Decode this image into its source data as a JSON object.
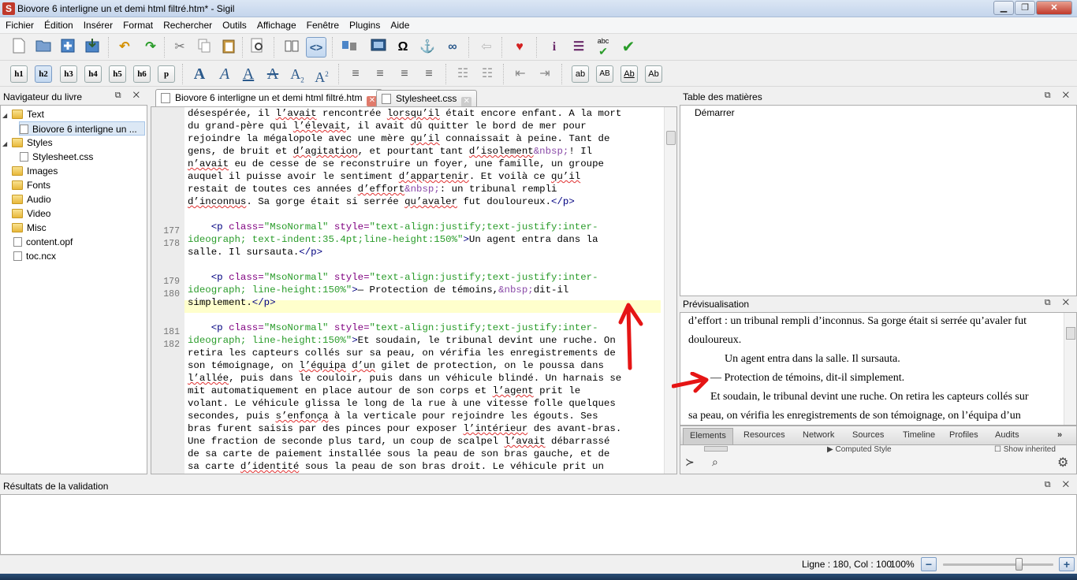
{
  "window": {
    "title": "Biovore 6 interligne un et demi html filtré.htm* - Sigil",
    "app_icon": "S"
  },
  "menu": [
    "Fichier",
    "Édition",
    "Insérer",
    "Format",
    "Rechercher",
    "Outils",
    "Affichage",
    "Fenêtre",
    "Plugins",
    "Aide"
  ],
  "toolbar2": {
    "headings": [
      "h1",
      "h2",
      "h3",
      "h4",
      "h5",
      "h6",
      "p"
    ],
    "active_heading": "h2",
    "abc_label": "abc",
    "case_buttons": [
      "ab",
      "AB",
      "Ab",
      "Ab"
    ]
  },
  "book_browser": {
    "title": "Navigateur du livre",
    "items": [
      {
        "label": "Text",
        "type": "folder",
        "expanded": true
      },
      {
        "label": "Biovore 6 interligne un ...",
        "type": "file",
        "selected": true
      },
      {
        "label": "Styles",
        "type": "folder",
        "expanded": true
      },
      {
        "label": "Stylesheet.css",
        "type": "file"
      },
      {
        "label": "Images",
        "type": "folder"
      },
      {
        "label": "Fonts",
        "type": "folder"
      },
      {
        "label": "Audio",
        "type": "folder"
      },
      {
        "label": "Video",
        "type": "folder"
      },
      {
        "label": "Misc",
        "type": "folder"
      },
      {
        "label": "content.opf",
        "type": "file"
      },
      {
        "label": "toc.ncx",
        "type": "file"
      }
    ]
  },
  "tabs": [
    {
      "label": "Biovore 6 interligne un et demi html filtré.htm",
      "active": true,
      "close": "✕"
    },
    {
      "label": "Stylesheet.css",
      "active": false,
      "close": "✕"
    }
  ],
  "code": {
    "line_numbers": [
      "177",
      "178",
      "179",
      "180",
      "181",
      "182"
    ],
    "highlight_color": "#ffffcc"
  },
  "toc": {
    "title": "Table des matières",
    "entry": "Démarrer"
  },
  "preview": {
    "title": "Prévisualisation",
    "lines": [
      "d’effort : un tribunal rempli d’inconnus. Sa gorge était si serrée qu’avaler fut",
      "douloureux.",
      "Un agent entra dans la salle. Il sursauta.",
      "— Protection de témoins, dit-il simplement.",
      "Et soudain, le tribunal devint une ruche. On retira les capteurs collés sur",
      "sa peau, on vérifia les enregistrements de son témoignage, on l’équipa d’un"
    ]
  },
  "devtools": {
    "tabs": [
      "Elements",
      "Resources",
      "Network",
      "Sources",
      "Timeline",
      "Profiles",
      "Audits"
    ],
    "more": "»",
    "computed": "Computed Style",
    "show_inherited": "Show inherited"
  },
  "validation": {
    "title": "Résultats de la validation"
  },
  "status": {
    "position": "Ligne : 180, Col : 100",
    "zoom": "100%",
    "zoom_minus": "−",
    "zoom_plus": "+",
    "zoom_level": 0.7
  },
  "colors": {
    "annotation_red": "#e51515",
    "selection": "#dce8f5"
  },
  "panel_buttons": "⧉ ✕"
}
